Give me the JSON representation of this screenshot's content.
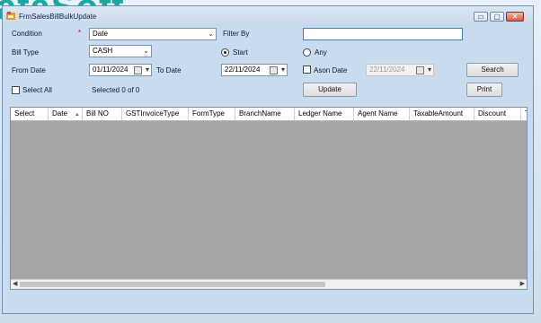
{
  "window": {
    "title": "FrmSalesBillBulkUpdate"
  },
  "window_controls": {
    "minimize": "▭",
    "maximize": "▢",
    "close": "✕"
  },
  "form": {
    "condition_label": "Condition",
    "required_mark": "*",
    "condition_value": "Date",
    "filter_by_label": "Filter By",
    "filter_by_value": "",
    "bill_type_label": "Bill Type",
    "bill_type_value": "CASH",
    "radio_start_label": "Start",
    "radio_any_label": "Any",
    "from_date_label": "From Date",
    "from_date_value": "01/11/2024",
    "to_date_label": "To Date",
    "to_date_value": "22/11/2024",
    "ason_date_label": "Ason Date",
    "ason_date_value": "22/11/2024",
    "search_label": "Search",
    "select_all_label": "Select All",
    "selected_status": "Selected 0 of 0",
    "update_label": "Update",
    "print_label": "Print"
  },
  "grid": {
    "columns": [
      "Select",
      "Date",
      "Bill NO",
      "GSTInvoiceType",
      "FormType",
      "BranchName",
      "Ledger Name",
      "Agent Name",
      "TaxableAmount",
      "Discount",
      "T"
    ]
  },
  "background_text": "ataSoft"
}
